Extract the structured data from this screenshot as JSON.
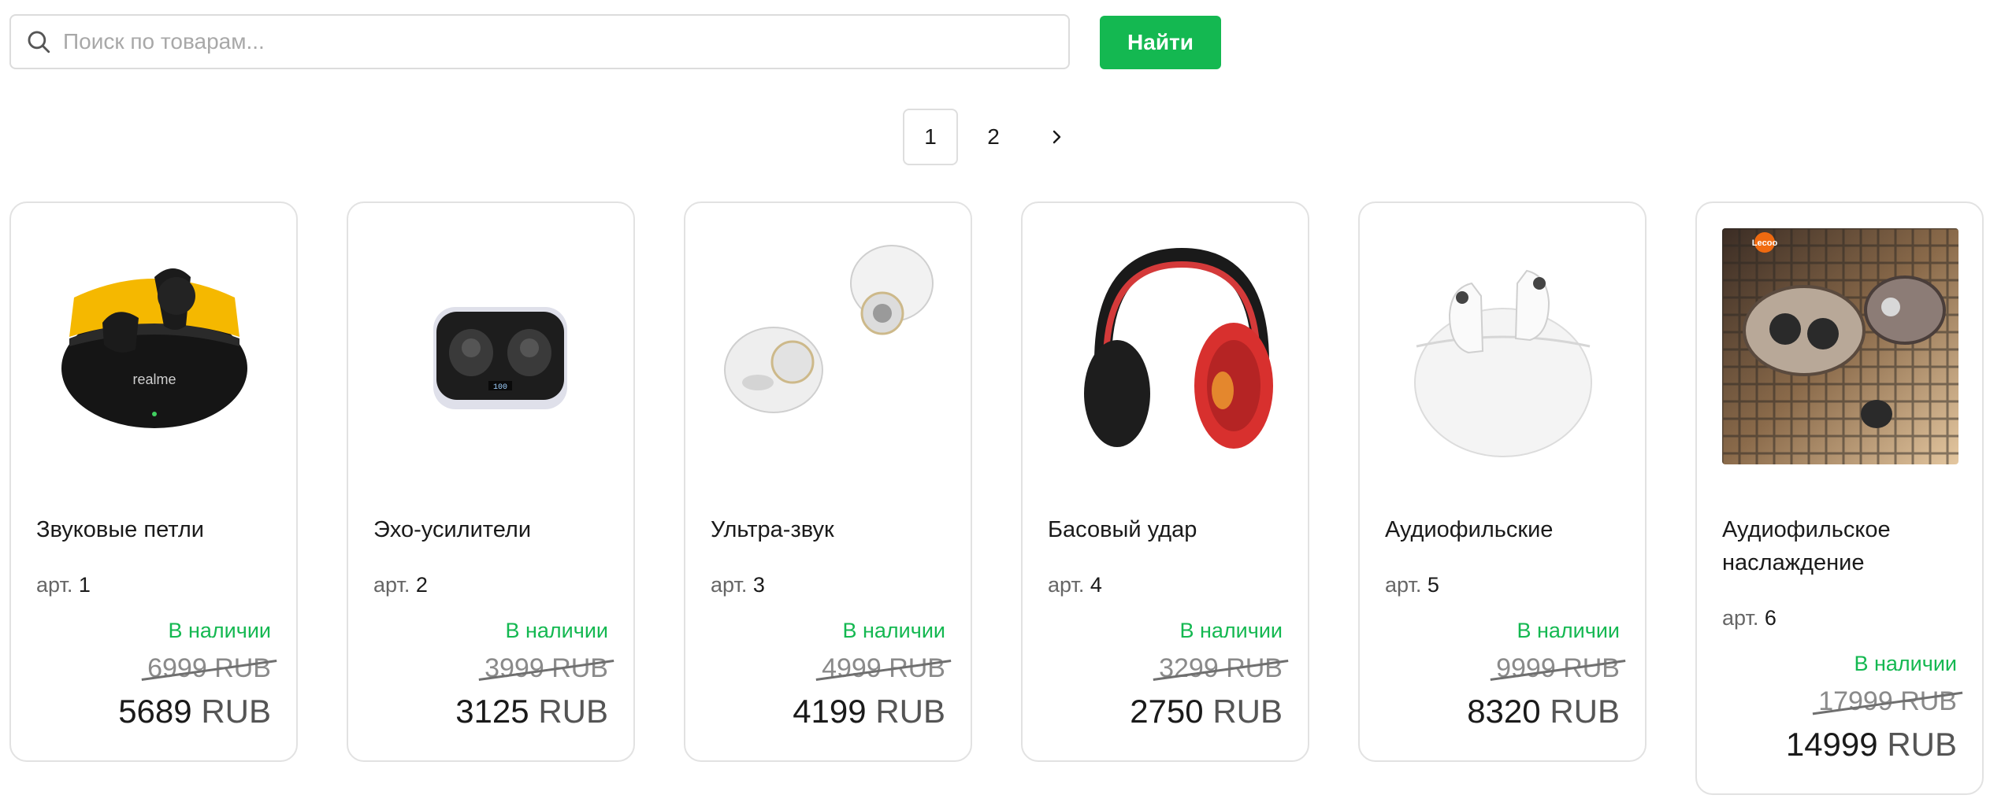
{
  "search": {
    "placeholder": "Поиск по товарам...",
    "value": "",
    "button_label": "Найти"
  },
  "pagination": {
    "pages": [
      "1",
      "2"
    ],
    "current": "1",
    "next_icon": "chevron-right-icon"
  },
  "colors": {
    "accent": "#14b851",
    "in_stock": "#14b851",
    "old_price": "#8a8a8a"
  },
  "products": [
    {
      "name": "Звуковые петли",
      "sku_label": "арт.",
      "sku": "1",
      "status": "В наличии",
      "old_price": "6999",
      "price": "5689",
      "currency": "RUB",
      "image": "black-yellow-earbuds-case"
    },
    {
      "name": "Эхо-усилители",
      "sku_label": "арт.",
      "sku": "2",
      "status": "В наличии",
      "old_price": "3999",
      "price": "3125",
      "currency": "RUB",
      "image": "dark-earbuds-led-case"
    },
    {
      "name": "Ультра-звук",
      "sku_label": "арт.",
      "sku": "3",
      "status": "В наличии",
      "old_price": "4999",
      "price": "4199",
      "currency": "RUB",
      "image": "white-earbuds-pair"
    },
    {
      "name": "Басовый удар",
      "sku_label": "арт.",
      "sku": "4",
      "status": "В наличии",
      "old_price": "3299",
      "price": "2750",
      "currency": "RUB",
      "image": "red-black-headphones"
    },
    {
      "name": "Аудиофильские",
      "sku_label": "арт.",
      "sku": "5",
      "status": "В наличии",
      "old_price": "9999",
      "price": "8320",
      "currency": "RUB",
      "image": "white-earbuds-case"
    },
    {
      "name": "Аудиофильское наслаждение",
      "sku_label": "арт.",
      "sku": "6",
      "status": "В наличии",
      "old_price": "17999",
      "price": "14999",
      "currency": "RUB",
      "image": "lecoo-earbuds-photo",
      "image_logo": "Lecoo"
    }
  ]
}
